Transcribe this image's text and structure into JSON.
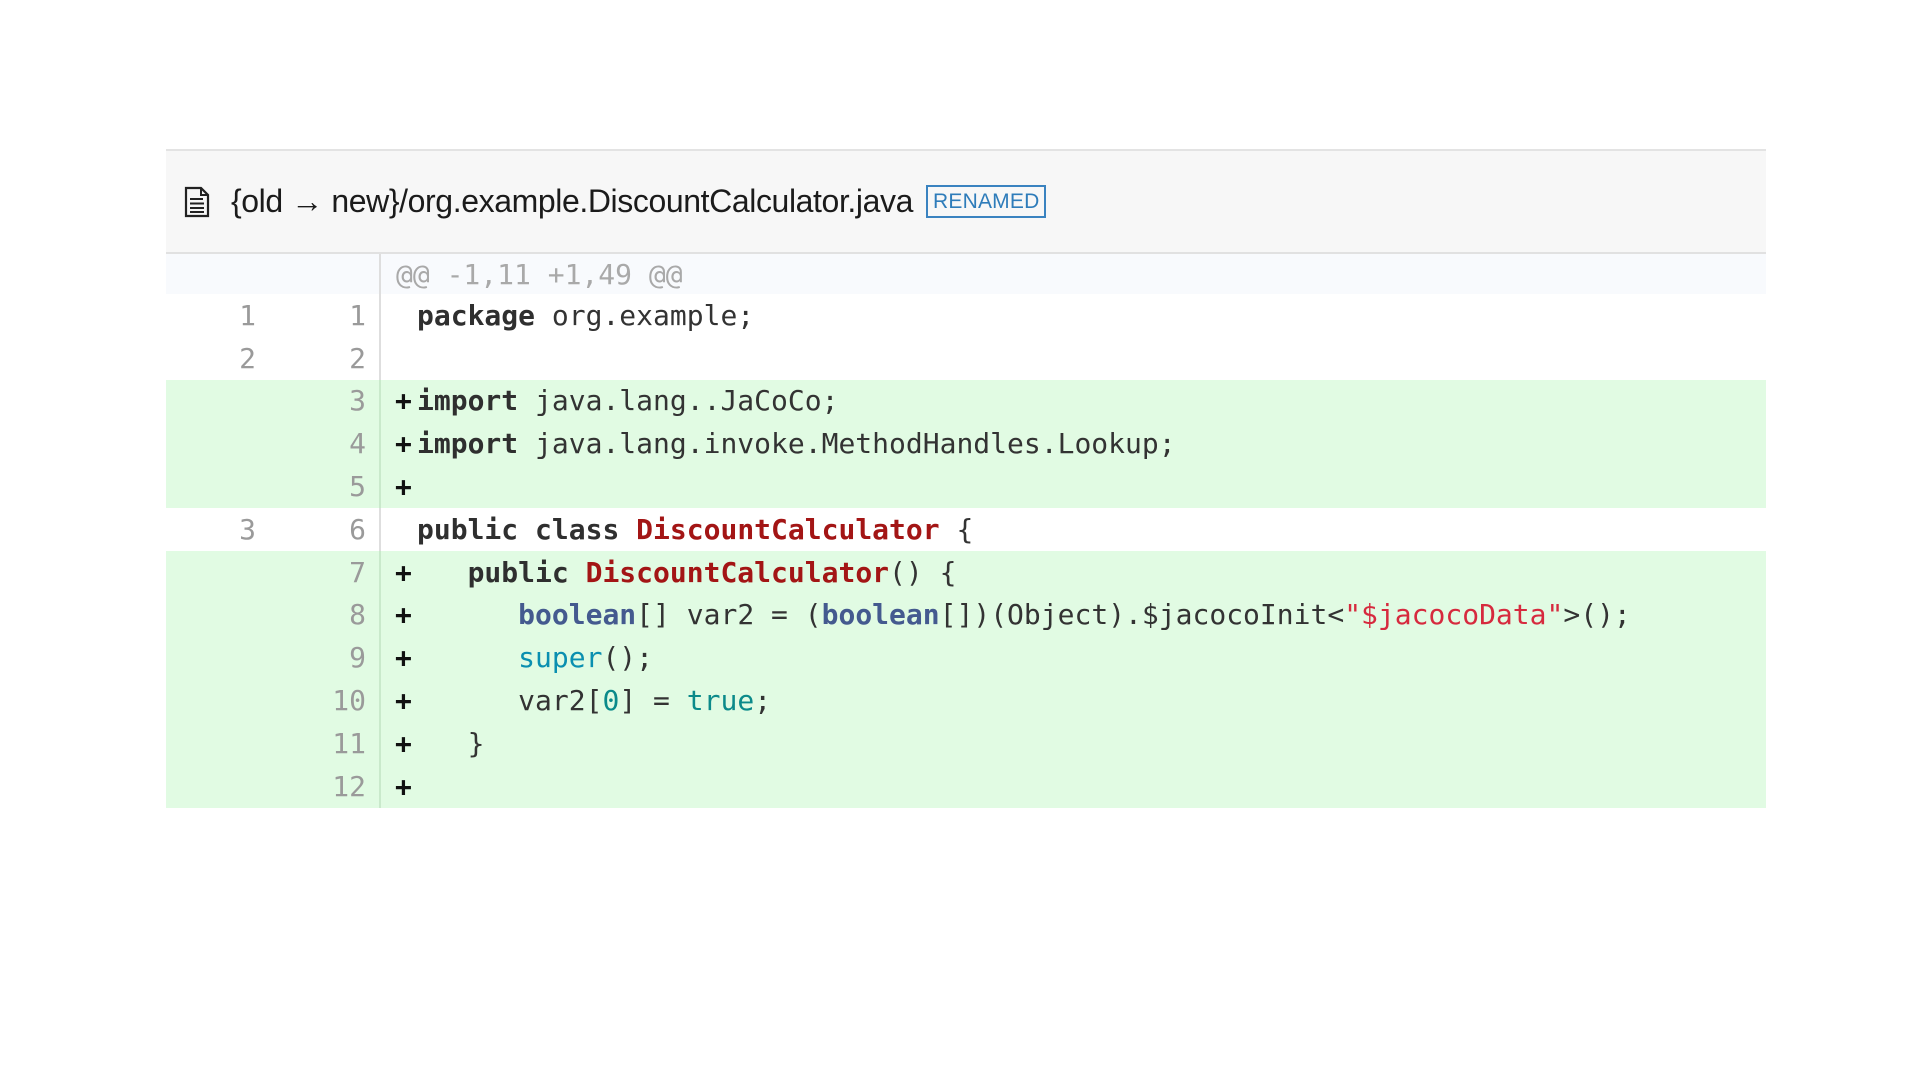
{
  "file": {
    "icon": "document-icon",
    "path": "{old → new}/org.example.DiscountCalculator.java",
    "badge": "RENAMED"
  },
  "hunk_header": "@@ -1,11 +1,49 @@",
  "lines": [
    {
      "old": "1",
      "new": "1",
      "type": "context",
      "marker": "",
      "indent": "",
      "tokens": [
        {
          "t": "package",
          "c": "kw"
        },
        {
          "t": " org.example;",
          "c": ""
        }
      ]
    },
    {
      "old": "2",
      "new": "2",
      "type": "context",
      "marker": "",
      "indent": "",
      "tokens": []
    },
    {
      "old": "",
      "new": "3",
      "type": "added",
      "marker": "+",
      "indent": "",
      "tokens": [
        {
          "t": "import",
          "c": "kw"
        },
        {
          "t": " java.lang..JaCoCo;",
          "c": ""
        }
      ]
    },
    {
      "old": "",
      "new": "4",
      "type": "added",
      "marker": "+",
      "indent": "",
      "tokens": [
        {
          "t": "import",
          "c": "kw"
        },
        {
          "t": " java.lang.invoke.MethodHandles.Lookup;",
          "c": ""
        }
      ]
    },
    {
      "old": "",
      "new": "5",
      "type": "added",
      "marker": "+",
      "indent": "",
      "tokens": []
    },
    {
      "old": "3",
      "new": "6",
      "type": "context",
      "marker": "",
      "indent": "",
      "tokens": [
        {
          "t": "public",
          "c": "kw"
        },
        {
          "t": " ",
          "c": ""
        },
        {
          "t": "class",
          "c": "kw"
        },
        {
          "t": " ",
          "c": ""
        },
        {
          "t": "DiscountCalculator",
          "c": "cls"
        },
        {
          "t": " {",
          "c": ""
        }
      ]
    },
    {
      "old": "",
      "new": "7",
      "type": "added",
      "marker": "+",
      "indent": "   ",
      "tokens": [
        {
          "t": "public",
          "c": "kw"
        },
        {
          "t": " ",
          "c": ""
        },
        {
          "t": "DiscountCalculator",
          "c": "cls"
        },
        {
          "t": "() {",
          "c": ""
        }
      ]
    },
    {
      "old": "",
      "new": "8",
      "type": "added",
      "marker": "+",
      "indent": "      ",
      "tokens": [
        {
          "t": "boolean",
          "c": "type"
        },
        {
          "t": "[] var2 = (",
          "c": ""
        },
        {
          "t": "boolean",
          "c": "type"
        },
        {
          "t": "[])(Object).$jacocoInit<",
          "c": ""
        },
        {
          "t": "\"$jacocoData\"",
          "c": "str"
        },
        {
          "t": ">();",
          "c": ""
        }
      ]
    },
    {
      "old": "",
      "new": "9",
      "type": "added",
      "marker": "+",
      "indent": "      ",
      "tokens": [
        {
          "t": "super",
          "c": "builtin"
        },
        {
          "t": "();",
          "c": ""
        }
      ]
    },
    {
      "old": "",
      "new": "10",
      "type": "added",
      "marker": "+",
      "indent": "      ",
      "tokens": [
        {
          "t": "var2[",
          "c": ""
        },
        {
          "t": "0",
          "c": "num"
        },
        {
          "t": "] = ",
          "c": ""
        },
        {
          "t": "true",
          "c": "lit"
        },
        {
          "t": ";",
          "c": ""
        }
      ]
    },
    {
      "old": "",
      "new": "11",
      "type": "added",
      "marker": "+",
      "indent": "   ",
      "tokens": [
        {
          "t": "}",
          "c": ""
        }
      ]
    },
    {
      "old": "",
      "new": "12",
      "type": "added",
      "marker": "+",
      "indent": "",
      "tokens": []
    }
  ]
}
